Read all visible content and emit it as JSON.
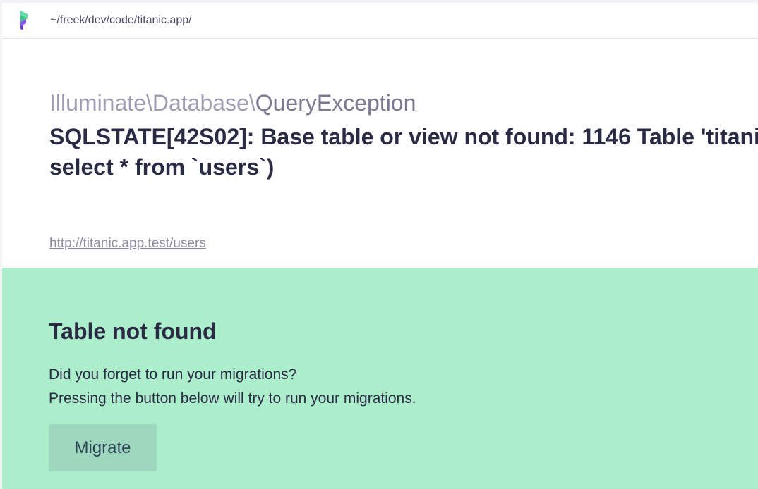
{
  "topbar": {
    "logo_icon": "ignition-logo-icon",
    "path": "~/freek/dev/code/titanic.app/"
  },
  "exception": {
    "class_prefix": "Illuminate\\Database\\",
    "class_name": "QueryException",
    "message_line1": "SQLSTATE[42S02]: Base table or view not found: 1146 Table 'titani",
    "message_line2": "select * from `users`)",
    "url": "http://titanic.app.test/users"
  },
  "solution": {
    "title": "Table not found",
    "line1": "Did you forget to run your migrations?",
    "line2": "Pressing the button below will try to run your migrations.",
    "button_label": "Migrate"
  },
  "colors": {
    "solution_bg": "#aceecc",
    "button_bg": "#9dd7be",
    "text_dark": "#2b2a45",
    "muted": "#9f9db2"
  }
}
